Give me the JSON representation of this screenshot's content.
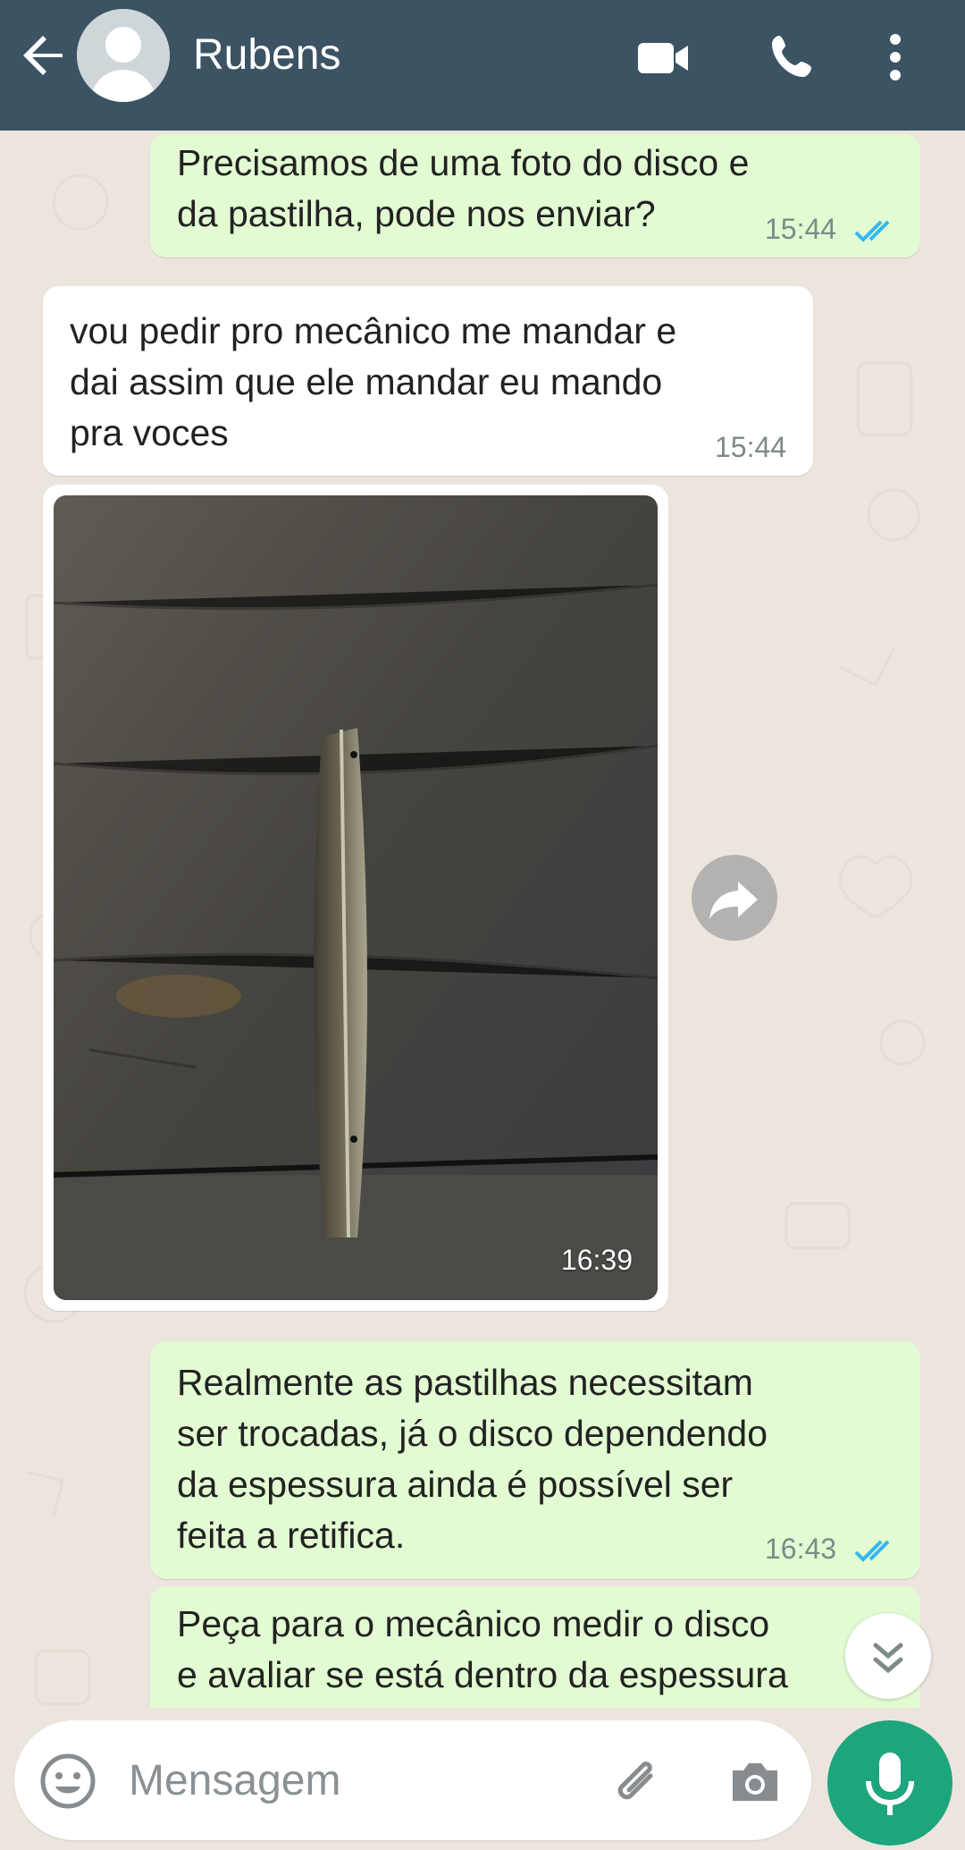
{
  "header": {
    "contact_name": "Rubens",
    "background_color": "#3b5363",
    "icons": [
      "back-arrow-icon",
      "avatar",
      "video-call-icon",
      "phone-icon",
      "more-options-icon"
    ]
  },
  "messages": [
    {
      "direction": "outgoing",
      "text": "Precisamos de uma foto do disco e\nda pastilha, pode nos enviar?",
      "time": "15:44",
      "status": "read"
    },
    {
      "direction": "incoming",
      "text": "vou pedir pro mecânico me mandar e\ndai assim que ele mandar eu mando\npra voces",
      "time": "15:44"
    },
    {
      "direction": "incoming",
      "type": "image",
      "time": "16:39"
    },
    {
      "direction": "outgoing",
      "text": "Realmente as pastilhas necessitam\nser trocadas, já o disco dependendo\nda espessura ainda é possível ser\nfeita a retifica.",
      "time": "16:43",
      "status": "read"
    },
    {
      "direction": "outgoing",
      "text": "Peça para o mecânico medir o disco\ne avaliar se está dentro da espessura"
    }
  ],
  "composer": {
    "placeholder": "Mensagem",
    "accent_color": "#1da57e"
  },
  "colors": {
    "outgoing_bubble": "#e2fbd2",
    "incoming_bubble": "#ffffff",
    "read_ticks": "#34b7f1",
    "chat_background": "#ece5dd"
  }
}
